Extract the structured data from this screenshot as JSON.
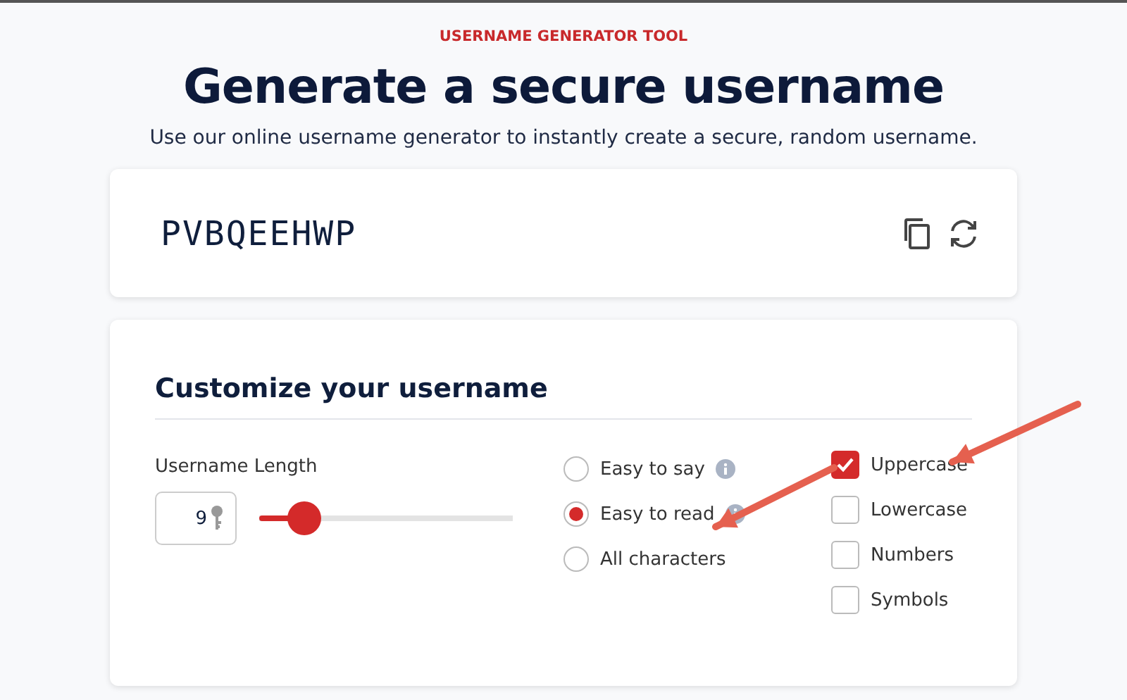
{
  "eyebrow": "USERNAME GENERATOR TOOL",
  "title": "Generate a secure username",
  "subtitle": "Use our online username generator to instantly create a secure, random username.",
  "result": {
    "username": "PVBQEEHWP"
  },
  "customize": {
    "heading": "Customize your username",
    "length_label": "Username Length",
    "length_value": "9",
    "slider": {
      "level": 0.18
    },
    "modes": [
      {
        "label": "Easy to say",
        "selected": false,
        "info": true
      },
      {
        "label": "Easy to read",
        "selected": true,
        "info": true
      },
      {
        "label": "All characters",
        "selected": false,
        "info": false
      }
    ],
    "charsets": [
      {
        "label": "Uppercase",
        "checked": true
      },
      {
        "label": "Lowercase",
        "checked": false
      },
      {
        "label": "Numbers",
        "checked": false
      },
      {
        "label": "Symbols",
        "checked": false
      }
    ]
  },
  "annotations": [
    {
      "kind": "arrow"
    },
    {
      "kind": "arrow"
    }
  ]
}
